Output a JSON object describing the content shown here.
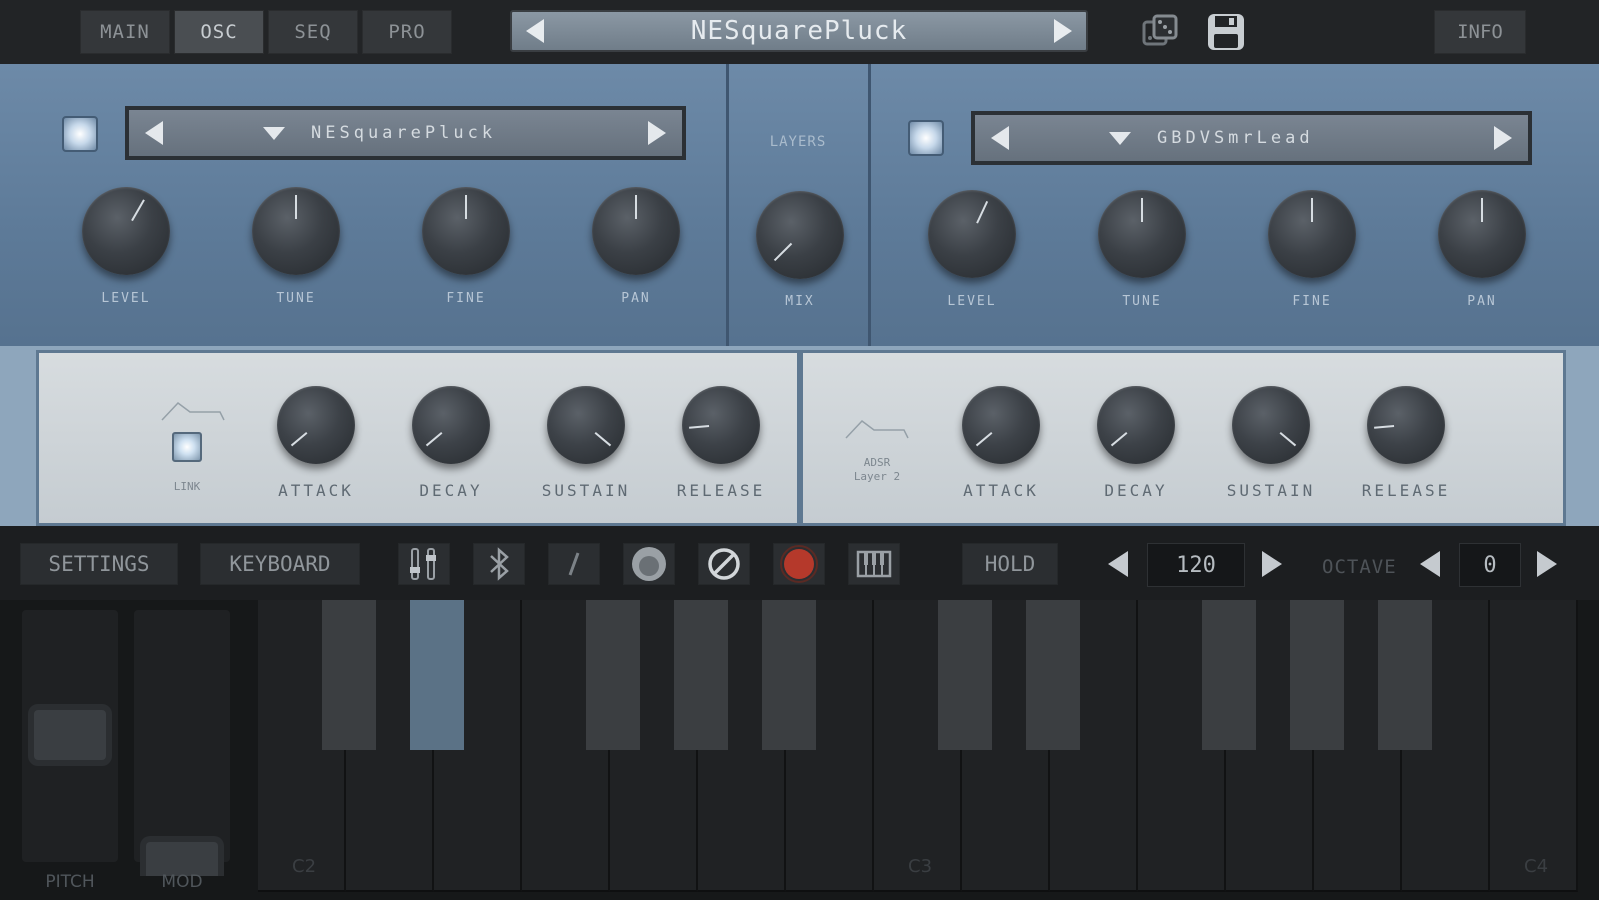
{
  "tabs": [
    {
      "label": "MAIN",
      "active": false
    },
    {
      "label": "OSC",
      "active": true
    },
    {
      "label": "SEQ",
      "active": false
    },
    {
      "label": "PRO",
      "active": false
    }
  ],
  "preset": {
    "name": "NESquarePluck"
  },
  "toolbar": {
    "randomize_icon": "dice-icon",
    "save_icon": "floppy-disk-icon",
    "info_label": "INFO"
  },
  "osc": {
    "layer1": {
      "wave": "NESquarePluck",
      "labels": [
        "LEVEL",
        "TUNE",
        "FINE",
        "PAN"
      ],
      "enabled": true
    },
    "layer2": {
      "wave": "GBDVSmrLead",
      "labels": [
        "LEVEL",
        "TUNE",
        "FINE",
        "PAN"
      ],
      "enabled": true
    },
    "layers_label": "LAYERS",
    "mix_label": "MIX"
  },
  "env": {
    "left": {
      "link_label": "LINK",
      "labels": [
        "ATTACK",
        "DECAY",
        "SUSTAIN",
        "RELEASE"
      ]
    },
    "right": {
      "adsr_line1": "ADSR",
      "adsr_line2": "Layer 2",
      "labels": [
        "ATTACK",
        "DECAY",
        "SUSTAIN",
        "RELEASE"
      ]
    }
  },
  "controls": {
    "settings_label": "SETTINGS",
    "keyboard_label": "KEYBOARD",
    "hold_label": "HOLD",
    "tempo": "120",
    "octave_label": "OCTAVE",
    "octave": "0",
    "icons": [
      "mixer-icon",
      "bluetooth-icon",
      "pencil-icon",
      "record-knob-icon",
      "cancel-icon",
      "record-icon",
      "piano-icon"
    ],
    "record_color": "#b5392b"
  },
  "keyboard": {
    "pitch_label": "PITCH",
    "mod_label": "MOD",
    "note_labels": [
      "C2",
      "C3",
      "C4"
    ],
    "pressed_key_color": "#5b7286"
  }
}
